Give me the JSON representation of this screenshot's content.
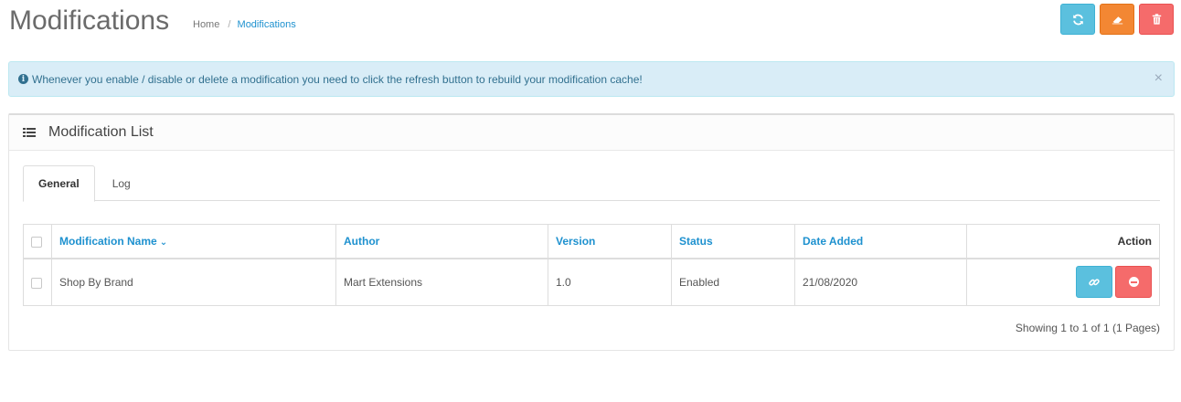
{
  "page": {
    "title": "Modifications",
    "breadcrumb": [
      {
        "label": "Home"
      },
      {
        "label": "Modifications"
      }
    ]
  },
  "header_buttons": [
    {
      "name": "refresh-button",
      "icon": "refresh-icon",
      "color": "#5bc0de"
    },
    {
      "name": "clear-button",
      "icon": "eraser-icon",
      "color": "#f38733"
    },
    {
      "name": "delete-button",
      "icon": "trash-icon",
      "color": "#f56b6b"
    }
  ],
  "alert": {
    "icon": "info-circle-icon",
    "text": "Whenever you enable / disable or delete a modification you need to click the refresh button to rebuild your modification cache!",
    "close": "×"
  },
  "panel": {
    "icon": "list-icon",
    "title": "Modification List"
  },
  "tabs": [
    {
      "label": "General",
      "active": true
    },
    {
      "label": "Log",
      "active": false
    }
  ],
  "table": {
    "columns": [
      "Modification Name",
      "Author",
      "Version",
      "Status",
      "Date Added",
      "Action"
    ],
    "sort_indicator": "chevron-down-icon",
    "rows": [
      {
        "name": "Shop By Brand",
        "author": "Mart Extensions",
        "version": "1.0",
        "status": "Enabled",
        "date_added": "21/08/2020"
      }
    ]
  },
  "pagination": {
    "text": "Showing 1 to 1 of 1 (1 Pages)"
  }
}
